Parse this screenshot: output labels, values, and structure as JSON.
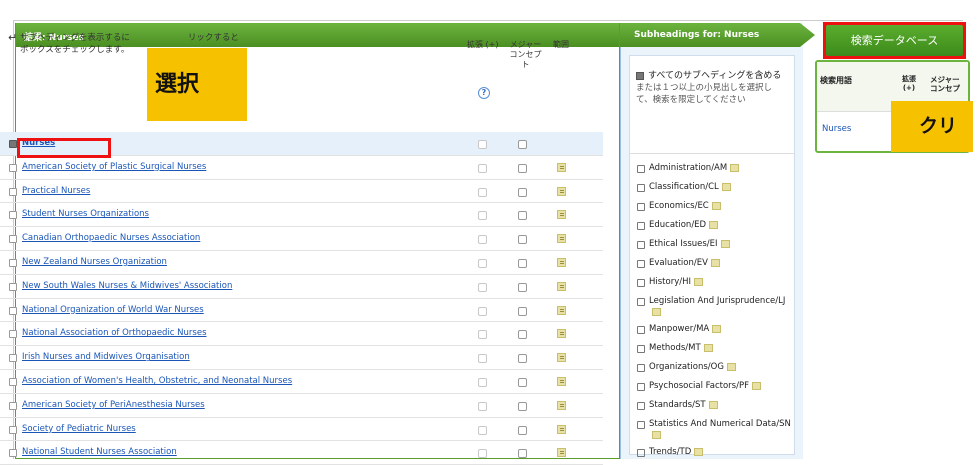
{
  "results": {
    "header": "結果: Nurses",
    "instructions_line1": "サブヘディングを表示するに",
    "instructions_line1b": "リックすると",
    "instructions_line2": "ボックスをチェックします。",
    "col_explode": "拡張 (+)",
    "col_major_line1": "メジャー",
    "col_major_line2": "コンセプ",
    "col_major_line3": "ト",
    "col_scope": "範囲",
    "help_icon": "?",
    "rows": [
      {
        "label": "Nurses",
        "checked": true
      },
      {
        "label": "American Society of Plastic Surgical Nurses",
        "checked": false
      },
      {
        "label": "Practical Nurses",
        "checked": false
      },
      {
        "label": "Student Nurses Organizations",
        "checked": false
      },
      {
        "label": "Canadian Orthopaedic Nurses Association",
        "checked": false
      },
      {
        "label": "New Zealand Nurses Organization",
        "checked": false
      },
      {
        "label": "New South Wales Nurses & Midwives' Association",
        "checked": false
      },
      {
        "label": "National Organization of World War Nurses",
        "checked": false
      },
      {
        "label": "National Association of Orthopaedic Nurses",
        "checked": false
      },
      {
        "label": "Irish Nurses and Midwives Organisation",
        "checked": false
      },
      {
        "label": "Association of Women's Health, Obstetric, and Neonatal Nurses",
        "checked": false
      },
      {
        "label": "American Society of PeriAnesthesia Nurses",
        "checked": false
      },
      {
        "label": "Society of Pediatric Nurses",
        "checked": false
      },
      {
        "label": "National Student Nurses Association",
        "checked": false
      }
    ]
  },
  "subheadings": {
    "header": "Subheadings for: Nurses",
    "include_all": "すべてのサブヘディングを含める",
    "note": "または１つ以上の小見出しを選択して、検索を限定してください",
    "items": [
      "Administration/AM",
      "Classification/CL",
      "Economics/EC",
      "Education/ED",
      "Ethical Issues/EI",
      "Evaluation/EV",
      "History/HI",
      "Legislation And Jurisprudence/LJ",
      "Manpower/MA",
      "Methods/MT",
      "Organizations/OG",
      "Psychosocial Factors/PF",
      "Standards/ST",
      "Statistics And Numerical Data/SN",
      "Trends/TD"
    ]
  },
  "right_panel": {
    "search_button": "検索データベース",
    "col_term": "検索用語",
    "col_explode": "拡張 (+)",
    "col_major_line1": "メジャー",
    "col_major_line2": "コンセプ",
    "term_value": "Nurses"
  },
  "annotations": {
    "select_label": "選択",
    "click_label": "クリ"
  },
  "colors": {
    "header_green": "#4b8f22",
    "highlight_red": "#ee1111",
    "annotation_yellow": "#f6c200",
    "link_blue": "#1a56b8"
  }
}
